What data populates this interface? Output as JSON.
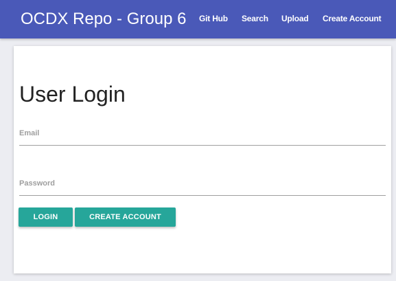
{
  "header": {
    "brand": "OCDX Repo - Group 6",
    "nav": {
      "github": "Git Hub",
      "search": "Search",
      "upload": "Upload",
      "create_account": "Create Account"
    }
  },
  "login_form": {
    "title": "User Login",
    "email_label": "Email",
    "email_value": "",
    "password_label": "Password",
    "password_value": "",
    "login_button": "LOGIN",
    "create_account_button": "CREATE ACCOUNT"
  },
  "colors": {
    "navbar": "#4a59b8",
    "button": "#26a69a",
    "page_background": "#ecedf2"
  }
}
